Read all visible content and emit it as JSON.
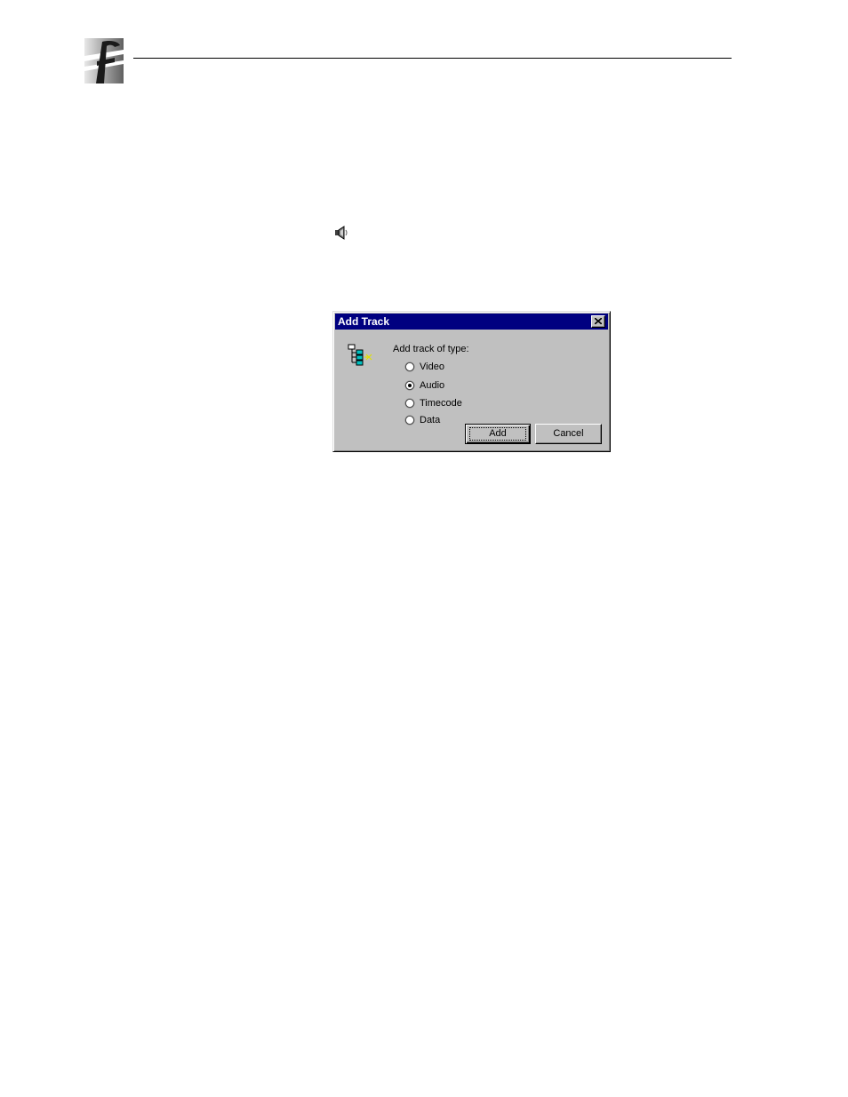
{
  "dialog": {
    "title": "Add Track",
    "prompt": "Add track of type:",
    "options": [
      {
        "label": "Video",
        "selected": false
      },
      {
        "label": "Audio",
        "selected": true
      },
      {
        "label": "Timecode",
        "selected": false
      },
      {
        "label": "Data",
        "selected": false
      }
    ],
    "add_label": "Add",
    "cancel_label": "Cancel"
  },
  "icons": {
    "logo": "company-logo-icon",
    "speaker": "speaker-icon",
    "tree": "track-tree-icon",
    "close": "close-icon"
  },
  "colors": {
    "titlebar": "#000080",
    "dialog_face": "#c0c0c0",
    "tree_icon_accent": "#00c0c0"
  }
}
